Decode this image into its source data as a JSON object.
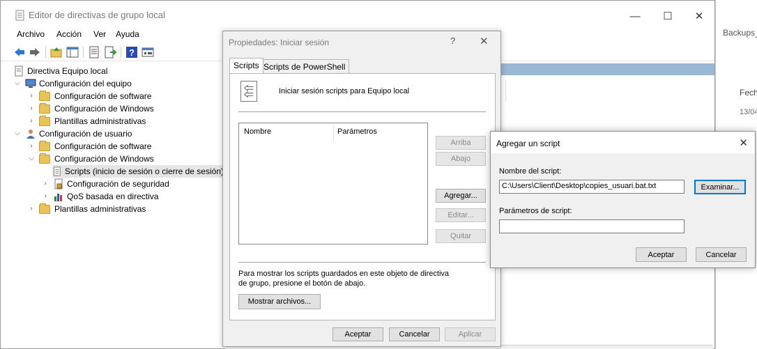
{
  "main_window": {
    "title": "Editor de directivas de grupo local",
    "controls": {
      "minimize": "—",
      "maximize": "☐",
      "close": "✕"
    },
    "menu": [
      "Archivo",
      "Acción",
      "Ver",
      "Ayuda"
    ],
    "tree": {
      "root": "Directiva Equipo local",
      "computer_config": "Configuración del equipo",
      "computer_software": "Configuración de software",
      "computer_windows": "Configuración de Windows",
      "computer_admin": "Plantillas administrativas",
      "user_config": "Configuración de usuario",
      "user_software": "Configuración de software",
      "user_windows": "Configuración de Windows",
      "scripts": "Scripts (inicio de sesión o cierre de sesión)",
      "security": "Configuración de seguridad",
      "qos": "QoS basada en directiva",
      "user_admin": "Plantillas administrativas"
    }
  },
  "background_window": {
    "title": "Backups_",
    "col_header": "Fecha",
    "cell": "13/04"
  },
  "properties_dialog": {
    "title": "Propiedades: Iniciar sesión",
    "help": "?",
    "close": "✕",
    "tabs": [
      "Scripts",
      "Scripts de PowerShell"
    ],
    "header_text": "Iniciar sesión scripts para Equipo local",
    "list_columns": [
      "Nombre",
      "Parámetros"
    ],
    "side_buttons": {
      "up": "Arriba",
      "down": "Abajo",
      "add": "Agregar...",
      "edit": "Editar...",
      "remove": "Quitar"
    },
    "info_text": "Para mostrar los scripts guardados en este objeto de directiva de grupo, presione el botón de abajo.",
    "show_files": "Mostrar archivos...",
    "footer": {
      "ok": "Aceptar",
      "cancel": "Cancelar",
      "apply": "Aplicar"
    }
  },
  "add_script_dialog": {
    "title": "Agregar un script",
    "close": "✕",
    "script_name_label": "Nombre del script:",
    "script_name_value": "C:\\Users\\Client\\Desktop\\copies_usuari.bat.txt",
    "browse": "Examinar...",
    "params_label": "Parámetros de script:",
    "params_value": "",
    "ok": "Aceptar",
    "cancel": "Cancelar"
  }
}
